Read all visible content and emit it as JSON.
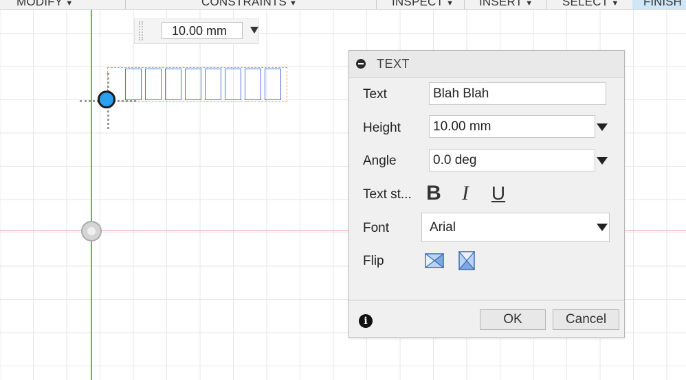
{
  "toolbar": {
    "items": [
      "MODIFY",
      "CONSTRAINTS",
      "INSPECT",
      "INSERT",
      "SELECT"
    ],
    "finish_label": "FINISH",
    "finish_color": "#cfe6f6"
  },
  "canvas": {
    "dimension_value": "10.00 mm",
    "axis_colors": {
      "y_axis": "#39d139",
      "x_axis": "#f0a0a0"
    },
    "point_color": "#2aa0f0"
  },
  "dialog": {
    "title": "TEXT",
    "text_label": "Text",
    "text_value": "Blah Blah",
    "height_label": "Height",
    "height_value": "10.00 mm",
    "angle_label": "Angle",
    "angle_value": "0.0 deg",
    "text_style_label": "Text st...",
    "style_buttons": {
      "bold": "B",
      "italic": "I",
      "underline": "U"
    },
    "font_label": "Font",
    "font_value": "Arial",
    "flip_label": "Flip",
    "ok_label": "OK",
    "cancel_label": "Cancel"
  }
}
